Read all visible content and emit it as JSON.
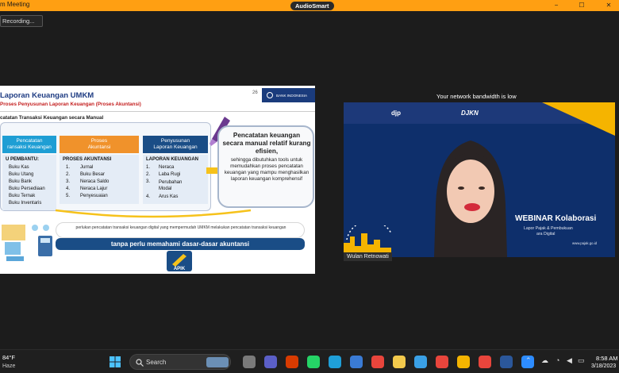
{
  "window": {
    "title": "m Meeting",
    "audio_pill": "AudioSmart",
    "recording": "Recording...",
    "controls": [
      "−",
      "☐",
      "✕"
    ]
  },
  "slide": {
    "title": "Laporan Keuangan UMKM",
    "subtitle": "Proses Penyusunan Laporan Keuangan (Proses Akuntansi)",
    "page_number": "26",
    "logo_text": "BANK INDONESIA",
    "section_title": "catatan Transaksi Keuangan secara Manual",
    "columns": [
      {
        "header": "Pencatatan\nransaksi Keuangan",
        "color": "#1e9ed4",
        "body_title": "U PEMBANTU:",
        "items": [
          "Buku Kas",
          "Buku Utang",
          "Buku Bank",
          "Buku Persediaan",
          "Buku Ternak",
          "Buku Inventaris"
        ]
      },
      {
        "header": "Proses\nAkuntansi",
        "color": "#f0922b",
        "body_title": "PROSES AKUNTANSI",
        "items": [
          "Jurnal",
          "Buku Besar",
          "Neraca Saldo",
          "Neraca Lajur",
          "Penyesuaian"
        ],
        "numbers": [
          "1.",
          "2.",
          "3.",
          "4.",
          "5."
        ]
      },
      {
        "header": "Penyusunan\nLaporan Keuangan",
        "color": "#1a4d86",
        "body_title": "LAPORAN KEUANGAN",
        "items": [
          "Neraca",
          "Laba Rugi",
          "Perubahan\nModal",
          "Arus Kas"
        ],
        "numbers": [
          "1.",
          "2.",
          "3.",
          "4."
        ]
      }
    ],
    "callout_bold": "Pencatatan keuangan secara manual relatif kurang efisien,",
    "callout_rest": "sehingga dibutuhkan tools untuk memudahkan proses pencatatan keuangan yang mampu menghasilkan laporan keuangan komprehensif",
    "bubble_text": "perlukan pencatatan transaksi keuangan digital yang mempermudah UMKM melakukan pencatatan transaksi keuangan",
    "blue_bar_text": "tanpa perlu memahami dasar-dasar akuntansi",
    "apik_label": "APIK"
  },
  "video": {
    "bandwidth_note": "Your network bandwidth is low",
    "logos": [
      "djp",
      "DJKN"
    ],
    "webinar_title": "WEBINAR Kolaborasi",
    "webinar_sub_1": "Lapor Pajak & Pembukuan",
    "webinar_sub_2": "ara Digital",
    "url": "www.pajak.go.id",
    "participant_name": "Wulan Retnowati"
  },
  "taskbar": {
    "temperature": "84°F",
    "condition": "Haze",
    "search_label": "Search",
    "time": "8:58 AM",
    "date": "3/18/2023",
    "apps": [
      {
        "name": "file-explorer-icon",
        "color": "#7a7a7a"
      },
      {
        "name": "teams-chat-icon",
        "color": "#5b5fc7"
      },
      {
        "name": "office-icon",
        "color": "#d83b01"
      },
      {
        "name": "whatsapp-icon",
        "color": "#25d366"
      },
      {
        "name": "edge-icon",
        "color": "#1f9fd8"
      },
      {
        "name": "mail-icon",
        "color": "#3a7bd5"
      },
      {
        "name": "chrome-icon",
        "color": "#e8453c"
      },
      {
        "name": "folder-icon",
        "color": "#f2c94c"
      },
      {
        "name": "photos-icon",
        "color": "#3aa0e6"
      },
      {
        "name": "chrome-profile-icon",
        "color": "#e8453c"
      },
      {
        "name": "chrome-profile-2-icon",
        "color": "#f4b400"
      },
      {
        "name": "chrome-profile-3-icon",
        "color": "#e8453c"
      },
      {
        "name": "word-icon",
        "color": "#2b579a"
      },
      {
        "name": "zoom-icon",
        "color": "#2d8cff"
      }
    ]
  }
}
